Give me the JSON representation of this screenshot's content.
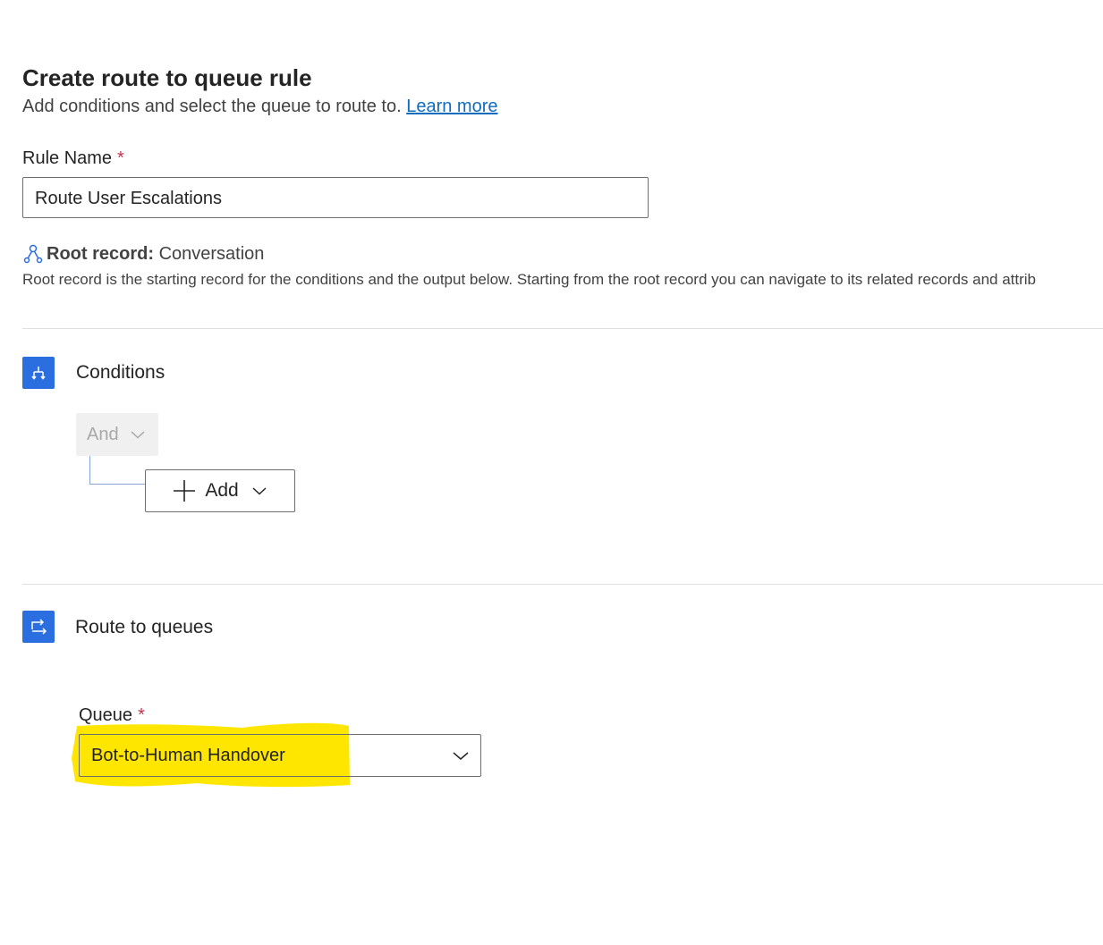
{
  "header": {
    "title": "Create route to queue rule",
    "subtitle": "Add conditions and select the queue to route to.",
    "learn_more": "Learn more"
  },
  "rule_name": {
    "label": "Rule Name",
    "required_mark": "*",
    "value": "Route User Escalations"
  },
  "root_record": {
    "label": "Root record:",
    "value": "Conversation",
    "icon": "root-record-icon",
    "description": "Root record is the starting record for the conditions and the output below. Starting from the root record you can navigate to its related records and attrib"
  },
  "conditions": {
    "title": "Conditions",
    "icon": "conditions-icon",
    "operator": "And",
    "add_label": "Add"
  },
  "route_to_queues": {
    "title": "Route to queues",
    "icon": "route-icon",
    "queue_label": "Queue",
    "required_mark": "*",
    "queue_value": "Bot-to-Human Handover"
  },
  "colors": {
    "accent": "#2b6ee0",
    "link": "#0f6cbd",
    "required": "#c4314b",
    "highlight": "#ffe600"
  }
}
